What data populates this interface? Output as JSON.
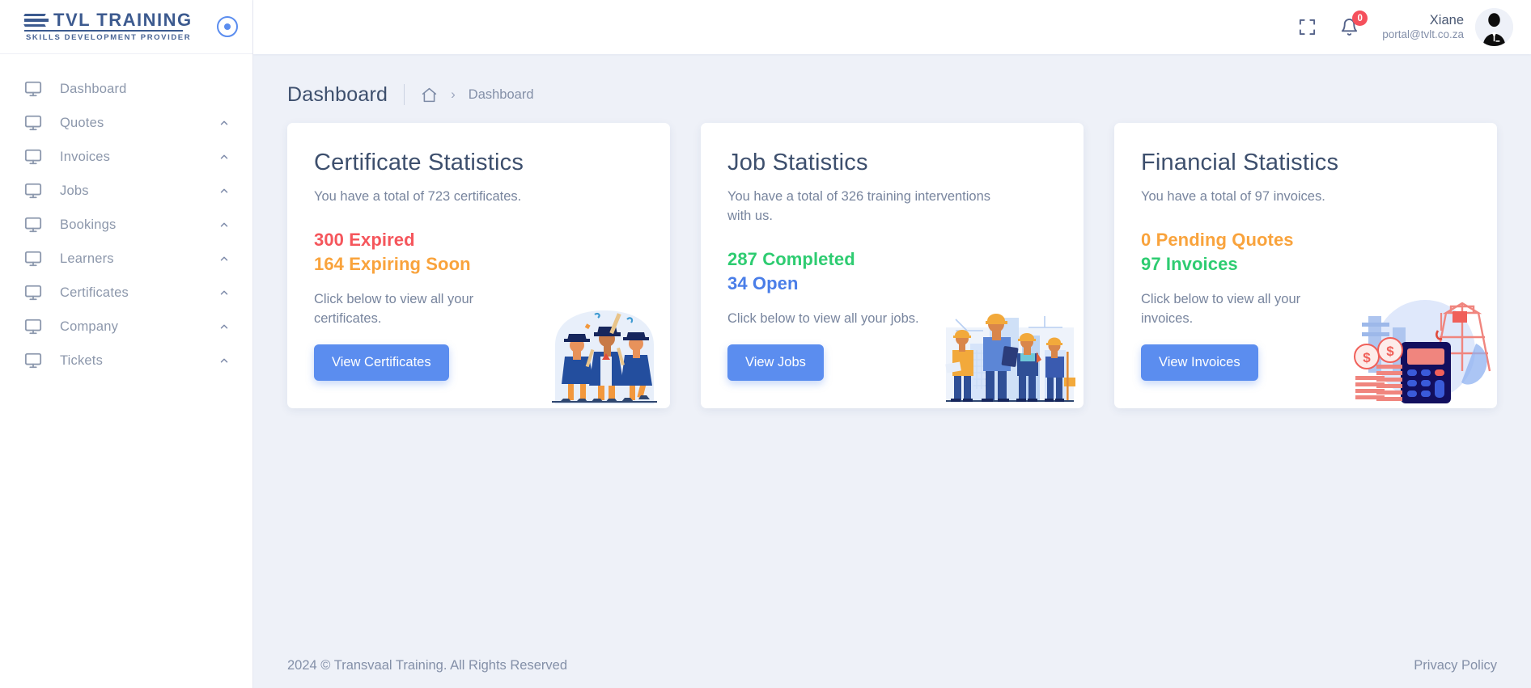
{
  "brand": {
    "logo_text": "TVL TRAINING",
    "logo_subtitle": "SKILLS DEVELOPMENT PROVIDER",
    "accent": "#5b8def"
  },
  "sidebar": {
    "toggle_icon": "target-circle-icon",
    "items": [
      {
        "label": "Dashboard",
        "icon": "monitor-icon",
        "expandable": false
      },
      {
        "label": "Quotes",
        "icon": "monitor-icon",
        "expandable": true
      },
      {
        "label": "Invoices",
        "icon": "monitor-icon",
        "expandable": true
      },
      {
        "label": "Jobs",
        "icon": "monitor-icon",
        "expandable": true
      },
      {
        "label": "Bookings",
        "icon": "monitor-icon",
        "expandable": true
      },
      {
        "label": "Learners",
        "icon": "monitor-icon",
        "expandable": true
      },
      {
        "label": "Certificates",
        "icon": "monitor-icon",
        "expandable": true
      },
      {
        "label": "Company",
        "icon": "monitor-icon",
        "expandable": true
      },
      {
        "label": "Tickets",
        "icon": "monitor-icon",
        "expandable": true
      }
    ]
  },
  "topbar": {
    "fullscreen_icon": "fullscreen-icon",
    "notifications": {
      "icon": "bell-icon",
      "count": "0",
      "badge_color": "#f5505c"
    },
    "user": {
      "name": "Xiane",
      "email": "portal@tvlt.co.za",
      "avatar": "user-avatar"
    }
  },
  "breadcrumb": {
    "title": "Dashboard",
    "home_icon": "home-icon",
    "separator": "›",
    "current": "Dashboard"
  },
  "cards": [
    {
      "title": "Certificate Statistics",
      "lead": "You have a total of 723 certificates.",
      "stats": [
        {
          "value": "300",
          "label": "Expired",
          "color": "#f5565c"
        },
        {
          "value": "164",
          "label": "Expiring Soon",
          "color": "#f9a33c"
        }
      ],
      "hint": "Click below to view all your certificates.",
      "button": "View Certificates",
      "art": "graduates-illustration"
    },
    {
      "title": "Job Statistics",
      "lead": "You have a total of 326 training interventions with us.",
      "stats": [
        {
          "value": "287",
          "label": "Completed",
          "color": "#2ecc71"
        },
        {
          "value": "34",
          "label": "Open",
          "color": "#4a7ee8"
        }
      ],
      "hint": "Click below to view all your jobs.",
      "button": "View Jobs",
      "art": "construction-workers-illustration"
    },
    {
      "title": "Financial Statistics",
      "lead": "You have a total of 97 invoices.",
      "stats": [
        {
          "value": "0",
          "label": "Pending Quotes",
          "color": "#f9a33c"
        },
        {
          "value": "97",
          "label": "Invoices",
          "color": "#2ecc71"
        }
      ],
      "hint": "Click below to view all your invoices.",
      "button": "View Invoices",
      "art": "calculator-coins-illustration"
    }
  ],
  "footer": {
    "copyright": "2024 © Transvaal Training. All Rights Reserved",
    "privacy": "Privacy Policy"
  }
}
